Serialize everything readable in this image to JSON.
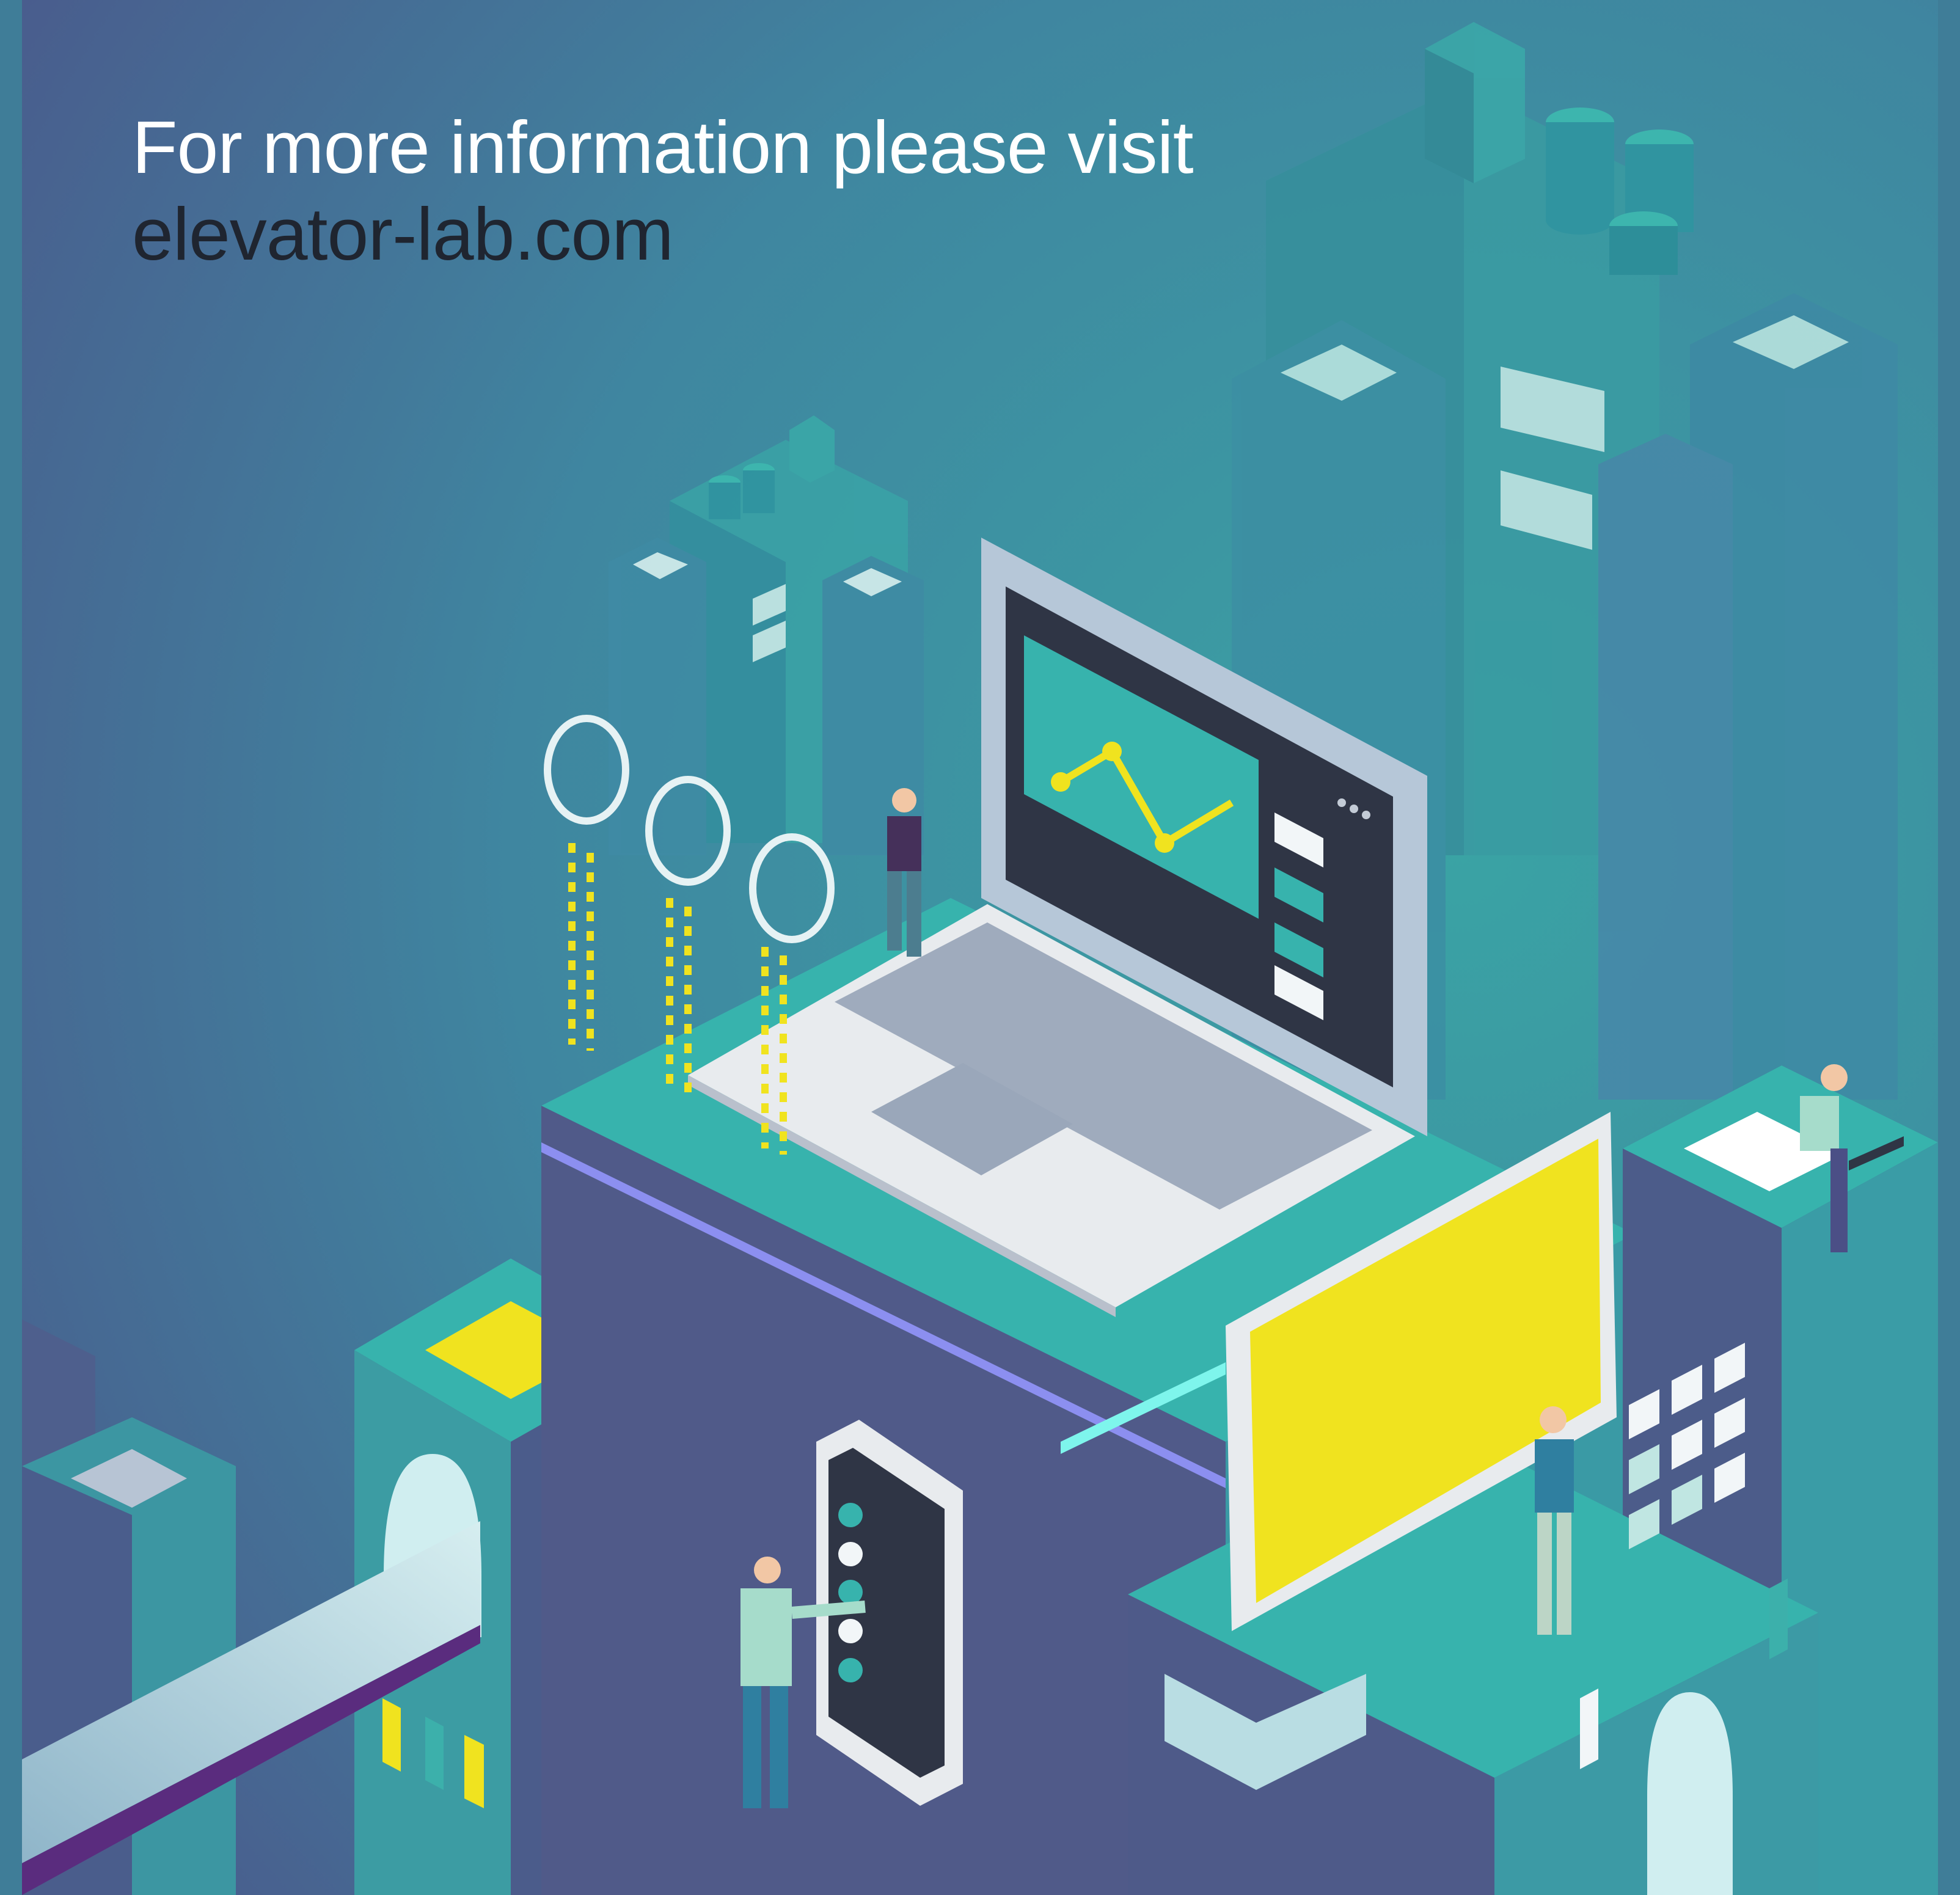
{
  "headline": {
    "line1": "For more information please visit",
    "line2": "elevator-lab.com"
  },
  "illustration": {
    "subject": "isometric city with laptop, phone, screen and people",
    "icons": [
      "laptop-icon",
      "line-chart-icon",
      "smartphone-icon",
      "billboard-icon",
      "folder-icon",
      "person-icon"
    ]
  },
  "colors": {
    "background_top": "#4a5c8a",
    "background_mid": "#3f8ea0",
    "teal": "#37b3ad",
    "teal_dark": "#2c8f93",
    "navy": "#4f5a88",
    "yellow": "#f0e31f",
    "screen_dark": "#2f3545",
    "white": "#ffffff",
    "light_gray": "#e8ebee"
  }
}
